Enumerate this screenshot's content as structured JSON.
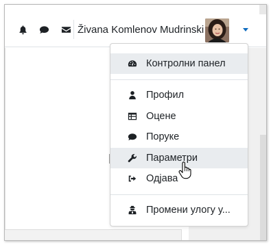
{
  "navbar": {
    "user_name": "Živana Komlenov Mudrinski",
    "icons": [
      "bell-icon",
      "chat-bubble-icon",
      "envelope-icon"
    ]
  },
  "user_menu": {
    "items": [
      {
        "label": "Контролни панел",
        "icon": "dashboard-icon",
        "highlighted": true
      },
      {
        "label": "Профил",
        "icon": "user-icon",
        "highlighted": false
      },
      {
        "label": "Оцене",
        "icon": "table-icon",
        "highlighted": false
      },
      {
        "label": "Поруке",
        "icon": "comment-icon",
        "highlighted": false
      },
      {
        "label": "Параметри",
        "icon": "wrench-icon",
        "highlighted": true
      },
      {
        "label": "Одјава",
        "icon": "sign-out-icon",
        "highlighted": false
      },
      {
        "label": "Промени улогу у...",
        "icon": "user-secret-icon",
        "highlighted": false
      }
    ]
  },
  "colors": {
    "caret": "#0f6cbf",
    "highlight": "#e9ecef",
    "text": "#1d2125"
  }
}
